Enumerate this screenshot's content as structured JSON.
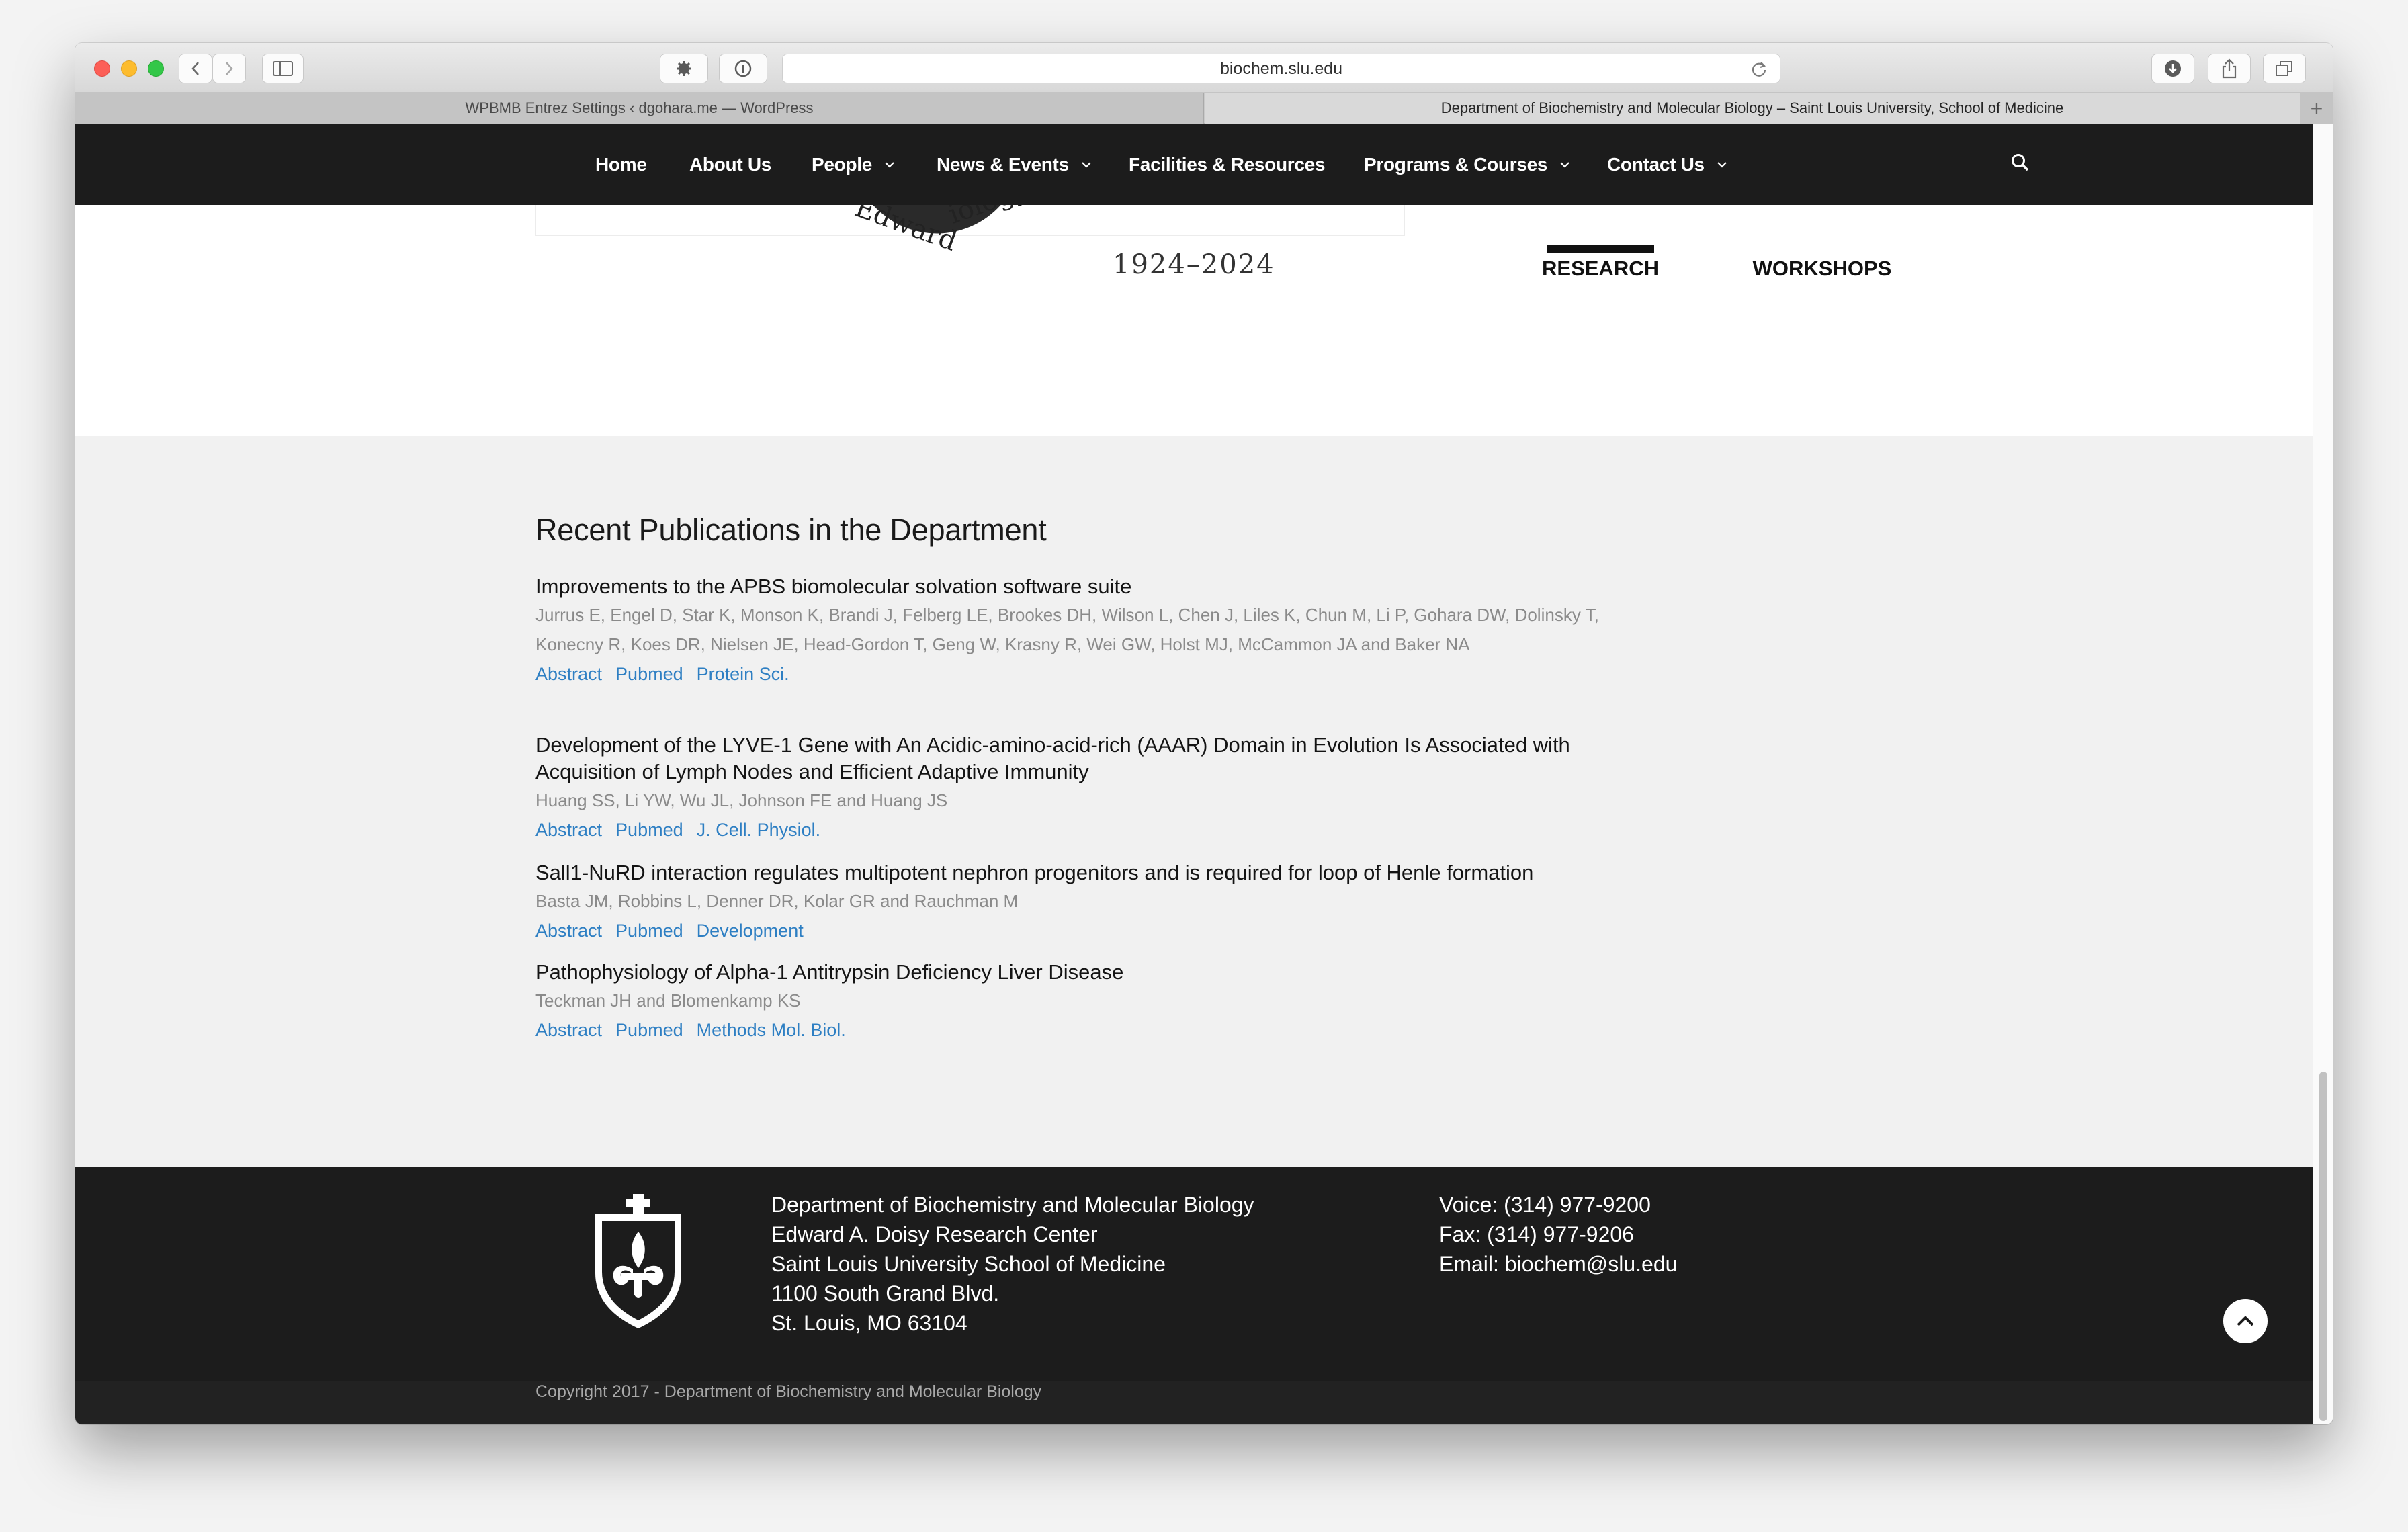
{
  "browser": {
    "url": "biochem.slu.edu",
    "tabs": [
      {
        "label": "WPBMB Entrez Settings ‹ dgohara.me — WordPress"
      },
      {
        "label": "Department of Biochemistry and Molecular Biology – Saint Louis University, School of Medicine"
      }
    ],
    "new_tab_label": "+"
  },
  "nav": {
    "items": [
      {
        "label": "Home",
        "has_dropdown": false
      },
      {
        "label": "About Us",
        "has_dropdown": false
      },
      {
        "label": "People",
        "has_dropdown": true
      },
      {
        "label": "News & Events",
        "has_dropdown": true
      },
      {
        "label": "Facilities & Resources",
        "has_dropdown": false
      },
      {
        "label": "Programs & Courses",
        "has_dropdown": true
      },
      {
        "label": "Contact Us",
        "has_dropdown": true
      }
    ]
  },
  "hero": {
    "seal_text_left": "Edward",
    "seal_text_right": "iology",
    "years": "1924–2024",
    "cta_1": "SUMMER RESEARCH",
    "cta_1_line2": "RESEARCH",
    "cta_2": "WORKSHOPS"
  },
  "publications": {
    "heading": "Recent Publications in the Department",
    "items": [
      {
        "title": "Improvements to the APBS biomolecular solvation software suite",
        "authors": "Jurrus E, Engel D, Star K, Monson K, Brandi J, Felberg LE, Brookes DH, Wilson L, Chen J, Liles K, Chun M, Li P, Gohara DW, Dolinsky T, Konecny R, Koes DR, Nielsen JE, Head-Gordon T, Geng W, Krasny R, Wei GW, Holst MJ, McCammon JA and Baker NA",
        "links": [
          "Abstract",
          "Pubmed",
          "Protein Sci."
        ]
      },
      {
        "title": "Development of the LYVE-1 Gene with An Acidic-amino-acid-rich (AAAR) Domain in Evolution Is Associated with Acquisition of Lymph Nodes and Efficient Adaptive Immunity",
        "authors": "Huang SS, Li YW, Wu JL, Johnson FE and Huang JS",
        "links": [
          "Abstract",
          "Pubmed",
          "J. Cell. Physiol."
        ]
      },
      {
        "title": "Sall1-NuRD interaction regulates multipotent nephron progenitors and is required for loop of Henle formation",
        "authors": "Basta JM, Robbins L, Denner DR, Kolar GR and Rauchman M",
        "links": [
          "Abstract",
          "Pubmed",
          "Development"
        ]
      },
      {
        "title": "Pathophysiology of Alpha-1 Antitrypsin Deficiency Liver Disease",
        "authors": "Teckman JH and Blomenkamp KS",
        "links": [
          "Abstract",
          "Pubmed",
          "Methods Mol. Biol."
        ]
      }
    ]
  },
  "footer": {
    "address_lines": [
      "Department of Biochemistry and Molecular Biology",
      "Edward A. Doisy Research Center",
      "Saint Louis University School of Medicine",
      "1100 South Grand Blvd.",
      "St. Louis, MO 63104"
    ],
    "contact_lines": [
      "Voice: (314) 977-9200",
      "Fax: (314) 977-9206",
      "Email: biochem@slu.edu"
    ],
    "copyright": "Copyright 2017 - Department of Biochemistry and Molecular Biology"
  },
  "colors": {
    "nav_bg": "#1c1c1c",
    "link": "#2e7fc3",
    "section_bg": "#f1f1f1",
    "footer_bg": "#1c1c1c"
  }
}
